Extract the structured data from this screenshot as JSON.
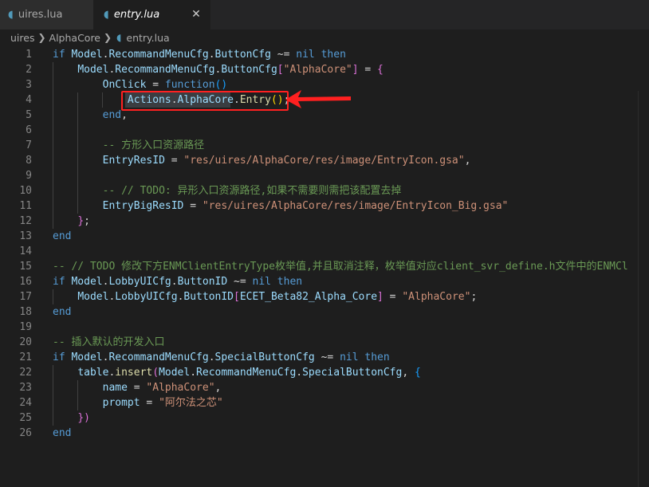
{
  "tabs": [
    {
      "label": "uires.lua",
      "icon": "lua-file-icon",
      "active": false
    },
    {
      "label": "entry.lua",
      "icon": "lua-file-icon",
      "active": true,
      "close": "✕"
    }
  ],
  "breadcrumb": [
    "uires",
    "AlphaCore",
    "entry.lua"
  ],
  "colors": {
    "keyword": "#569cd6",
    "identifier": "#9cdcfe",
    "function": "#dcdcaa",
    "string": "#ce9178",
    "comment": "#6a9955",
    "bracket1": "#ffd700",
    "bracket2": "#da70d6",
    "bracket3": "#179fff",
    "plain": "#d4d4d4",
    "annotation": "#ff2020"
  },
  "lines": [
    {
      "n": "1",
      "t": [
        [
          "if ",
          "keyword"
        ],
        [
          "Model",
          "identifier"
        ],
        [
          ".",
          "plain"
        ],
        [
          "RecommandMenuCfg",
          "identifier"
        ],
        [
          ".",
          "plain"
        ],
        [
          "ButtonCfg",
          "identifier"
        ],
        [
          " ~= ",
          "plain"
        ],
        [
          "nil",
          "keyword"
        ],
        [
          " then",
          "keyword"
        ]
      ]
    },
    {
      "n": "2",
      "t": [
        [
          "    ",
          "plain"
        ],
        [
          "Model",
          "identifier"
        ],
        [
          ".",
          "plain"
        ],
        [
          "RecommandMenuCfg",
          "identifier"
        ],
        [
          ".",
          "plain"
        ],
        [
          "ButtonCfg",
          "identifier"
        ],
        [
          "[",
          "bracket2"
        ],
        [
          "\"AlphaCore\"",
          "string"
        ],
        [
          "]",
          "bracket2"
        ],
        [
          " = ",
          "plain"
        ],
        [
          "{",
          "bracket2"
        ]
      ]
    },
    {
      "n": "3",
      "t": [
        [
          "        ",
          "plain"
        ],
        [
          "OnClick",
          "identifier"
        ],
        [
          " = ",
          "plain"
        ],
        [
          "function",
          "keyword"
        ],
        [
          "()",
          "bracket3"
        ]
      ]
    },
    {
      "n": "4",
      "t": [
        [
          "            ",
          "plain"
        ],
        [
          "Actions",
          "identifier"
        ],
        [
          ".",
          "plain"
        ],
        [
          "AlphaCore",
          "identifier"
        ],
        [
          ".",
          "plain"
        ],
        [
          "Entry",
          "function"
        ],
        [
          "()",
          "bracket1"
        ],
        [
          ";",
          "plain"
        ]
      ]
    },
    {
      "n": "5",
      "t": [
        [
          "        ",
          "plain"
        ],
        [
          "end",
          "keyword"
        ],
        [
          ",",
          "plain"
        ]
      ]
    },
    {
      "n": "6",
      "t": []
    },
    {
      "n": "7",
      "t": [
        [
          "        ",
          "plain"
        ],
        [
          "-- 方形入口资源路径",
          "comment"
        ]
      ]
    },
    {
      "n": "8",
      "t": [
        [
          "        ",
          "plain"
        ],
        [
          "EntryResID",
          "identifier"
        ],
        [
          " = ",
          "plain"
        ],
        [
          "\"res/uires/AlphaCore/res/image/EntryIcon.gsa\"",
          "string"
        ],
        [
          ",",
          "plain"
        ]
      ]
    },
    {
      "n": "9",
      "t": []
    },
    {
      "n": "10",
      "t": [
        [
          "        ",
          "plain"
        ],
        [
          "-- // TODO: 异形入口资源路径,如果不需要则需把该配置去掉",
          "comment"
        ]
      ]
    },
    {
      "n": "11",
      "t": [
        [
          "        ",
          "plain"
        ],
        [
          "EntryBigResID",
          "identifier"
        ],
        [
          " = ",
          "plain"
        ],
        [
          "\"res/uires/AlphaCore/res/image/EntryIcon_Big.gsa\"",
          "string"
        ]
      ]
    },
    {
      "n": "12",
      "t": [
        [
          "    ",
          "plain"
        ],
        [
          "}",
          "bracket2"
        ],
        [
          ";",
          "plain"
        ]
      ]
    },
    {
      "n": "13",
      "t": [
        [
          "end",
          "keyword"
        ]
      ]
    },
    {
      "n": "14",
      "t": []
    },
    {
      "n": "15",
      "t": [
        [
          "-- // TODO 修改下方ENMClientEntryType枚举值,并且取消注释，枚举值对应client_svr_define.h文件中的ENMCl",
          "comment"
        ]
      ]
    },
    {
      "n": "16",
      "t": [
        [
          "if ",
          "keyword"
        ],
        [
          "Model",
          "identifier"
        ],
        [
          ".",
          "plain"
        ],
        [
          "LobbyUICfg",
          "identifier"
        ],
        [
          ".",
          "plain"
        ],
        [
          "ButtonID",
          "identifier"
        ],
        [
          " ~= ",
          "plain"
        ],
        [
          "nil",
          "keyword"
        ],
        [
          " then",
          "keyword"
        ]
      ]
    },
    {
      "n": "17",
      "t": [
        [
          "    ",
          "plain"
        ],
        [
          "Model",
          "identifier"
        ],
        [
          ".",
          "plain"
        ],
        [
          "LobbyUICfg",
          "identifier"
        ],
        [
          ".",
          "plain"
        ],
        [
          "ButtonID",
          "identifier"
        ],
        [
          "[",
          "bracket2"
        ],
        [
          "ECET_Beta82_Alpha_Core",
          "identifier"
        ],
        [
          "]",
          "bracket2"
        ],
        [
          " = ",
          "plain"
        ],
        [
          "\"AlphaCore\"",
          "string"
        ],
        [
          ";",
          "plain"
        ]
      ]
    },
    {
      "n": "18",
      "t": [
        [
          "end",
          "keyword"
        ]
      ]
    },
    {
      "n": "19",
      "t": []
    },
    {
      "n": "20",
      "t": [
        [
          "-- 插入默认的开发入口",
          "comment"
        ]
      ]
    },
    {
      "n": "21",
      "t": [
        [
          "if ",
          "keyword"
        ],
        [
          "Model",
          "identifier"
        ],
        [
          ".",
          "plain"
        ],
        [
          "RecommandMenuCfg",
          "identifier"
        ],
        [
          ".",
          "plain"
        ],
        [
          "SpecialButtonCfg",
          "identifier"
        ],
        [
          " ~= ",
          "plain"
        ],
        [
          "nil",
          "keyword"
        ],
        [
          " then",
          "keyword"
        ]
      ]
    },
    {
      "n": "22",
      "t": [
        [
          "    ",
          "plain"
        ],
        [
          "table",
          "identifier"
        ],
        [
          ".",
          "plain"
        ],
        [
          "insert",
          "function"
        ],
        [
          "(",
          "bracket2"
        ],
        [
          "Model",
          "identifier"
        ],
        [
          ".",
          "plain"
        ],
        [
          "RecommandMenuCfg",
          "identifier"
        ],
        [
          ".",
          "plain"
        ],
        [
          "SpecialButtonCfg",
          "identifier"
        ],
        [
          ", ",
          "plain"
        ],
        [
          "{",
          "bracket3"
        ]
      ]
    },
    {
      "n": "23",
      "t": [
        [
          "        ",
          "plain"
        ],
        [
          "name",
          "identifier"
        ],
        [
          " = ",
          "plain"
        ],
        [
          "\"AlphaCore\"",
          "string"
        ],
        [
          ",",
          "plain"
        ]
      ]
    },
    {
      "n": "24",
      "t": [
        [
          "        ",
          "plain"
        ],
        [
          "prompt",
          "identifier"
        ],
        [
          " = ",
          "plain"
        ],
        [
          "\"阿尔法之芯\"",
          "string"
        ]
      ]
    },
    {
      "n": "25",
      "t": [
        [
          "    ",
          "plain"
        ],
        [
          "})",
          "bracket2"
        ]
      ]
    },
    {
      "n": "26",
      "t": [
        [
          "end",
          "keyword"
        ]
      ]
    }
  ]
}
